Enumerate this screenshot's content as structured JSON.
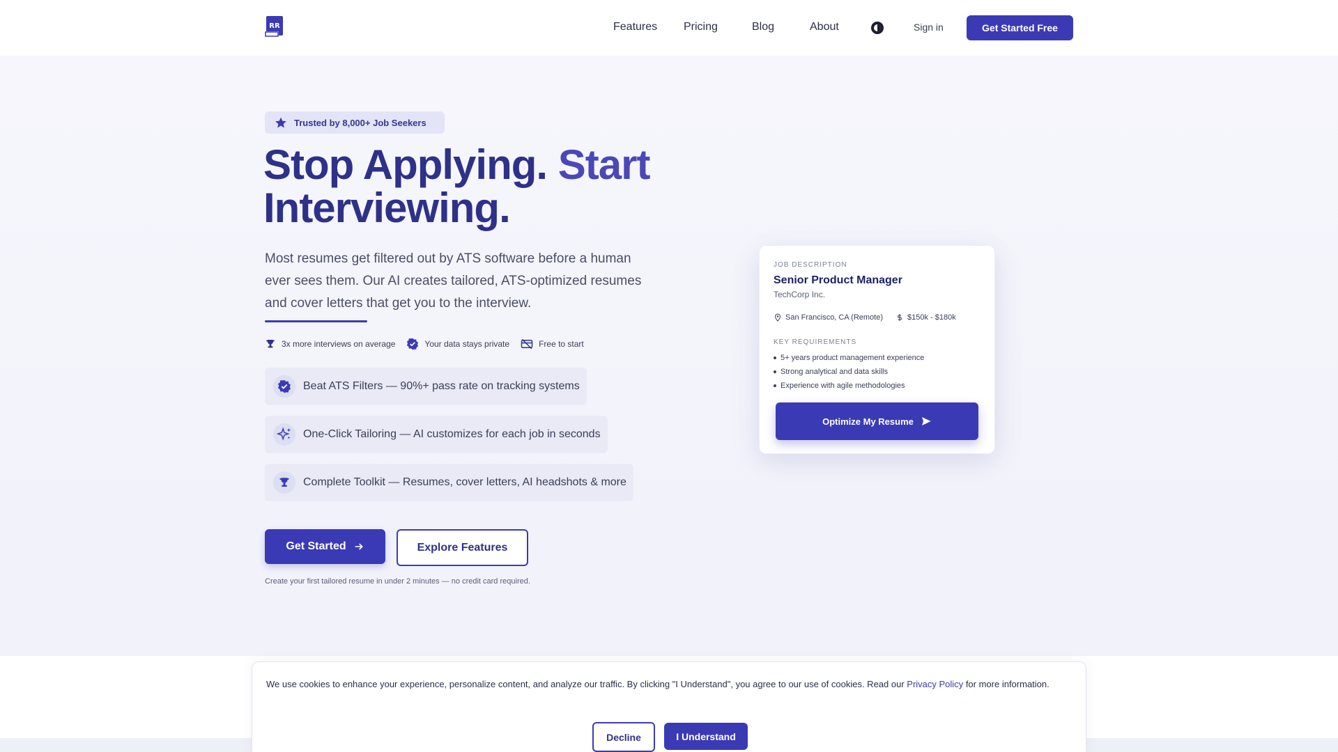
{
  "nav": {
    "links": [
      "Features",
      "Pricing",
      "Blog",
      "About"
    ],
    "theme_icon": "theme-toggle-icon",
    "signin_label": "Sign in",
    "cta_label": "Get Started Free",
    "logo_text": "RR"
  },
  "hero": {
    "badge": "Trusted by 8,000+ Job Seekers",
    "headline_part1": "Stop Applying.",
    "headline_part2": "Start",
    "headline_part3": "Interviewing.",
    "subtext": "Most resumes get filtered out by ATS software before a human ever sees them. Our AI creates tailored, ATS-optimized resumes and cover letters that get you to the interview.",
    "perks": [
      {
        "icon": "trophy-icon",
        "label": "3x more interviews on average"
      },
      {
        "icon": "verified-badge-icon",
        "label": "Your data stays private"
      },
      {
        "icon": "no-credit-card-icon",
        "label": "Free to start"
      }
    ],
    "features": [
      {
        "icon": "check-badge-icon",
        "label": "Beat ATS Filters — 90%+ pass rate on tracking systems"
      },
      {
        "icon": "sparkles-icon",
        "label": "One-Click Tailoring — AI customizes for each job in seconds"
      },
      {
        "icon": "trophy-icon",
        "label": "Complete Toolkit — Resumes, cover letters, AI headshots & more"
      }
    ],
    "primary_cta": "Get Started",
    "secondary_cta": "Explore Features",
    "fineprint": "Create your first tailored resume in under 2 minutes — no credit card required."
  },
  "job_card": {
    "label": "JOB DESCRIPTION",
    "title": "Senior Product Manager",
    "company": "TechCorp Inc.",
    "location": "San Francisco, CA (Remote)",
    "salary": "$150k - $180k",
    "requirements_label": "KEY REQUIREMENTS",
    "requirements": [
      "5+ years product management experience",
      "Strong analytical and data skills",
      "Experience with agile methodologies"
    ],
    "button_label": "Optimize My Resume"
  },
  "cookie": {
    "text_before": "We use cookies to enhance your experience, personalize content, and analyze our traffic. By clicking \"I Understand\", you agree to our use of cookies. Read our ",
    "link_label": "Privacy Policy",
    "text_after": " for more information.",
    "decline_label": "Decline",
    "accept_label": "I Understand"
  },
  "colors": {
    "brand": "#3b3ab5",
    "heading": "#2e3188",
    "background": "#f4f5fb"
  }
}
